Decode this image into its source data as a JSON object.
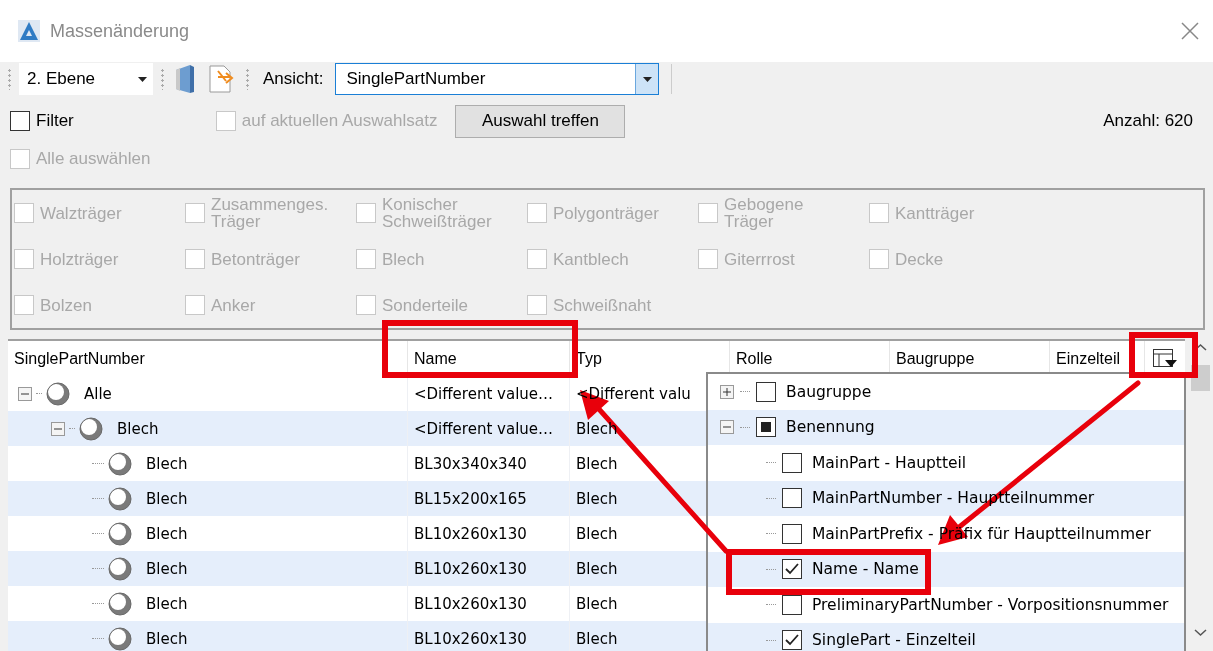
{
  "window": {
    "title": "Massenänderung"
  },
  "toolbar": {
    "level_combo": {
      "value": "2. Ebene"
    },
    "view_label": "Ansicht:",
    "view_combo": {
      "value": "SinglePartNumber"
    }
  },
  "filter": {
    "filter_checkbox": {
      "label": "Filter",
      "checked": false,
      "disabled": false
    },
    "selection_set_checkbox": {
      "label": "auf aktuellen Auswahlsatz",
      "checked": false,
      "disabled": true
    },
    "select_button": "Auswahl treffen",
    "count": "Anzahl: 620",
    "select_all": {
      "label": "Alle auswählen",
      "checked": false,
      "disabled": true
    }
  },
  "categories": [
    {
      "label": "Walzträger",
      "checked": false,
      "disabled": true
    },
    {
      "label": "Zusammenges.\nTräger",
      "checked": false,
      "disabled": true
    },
    {
      "label": "Konischer\nSchweißträger",
      "checked": false,
      "disabled": true
    },
    {
      "label": "Polygonträger",
      "checked": false,
      "disabled": true
    },
    {
      "label": "Gebogene\nTräger",
      "checked": false,
      "disabled": true
    },
    {
      "label": "Kantträger",
      "checked": false,
      "disabled": true
    },
    {
      "label": "Holzträger",
      "checked": false,
      "disabled": true
    },
    {
      "label": "Betonträger",
      "checked": false,
      "disabled": true
    },
    {
      "label": "Blech",
      "checked": false,
      "disabled": true
    },
    {
      "label": "Kantblech",
      "checked": false,
      "disabled": true
    },
    {
      "label": "Giterrrost",
      "checked": false,
      "disabled": true
    },
    {
      "label": "Decke",
      "checked": false,
      "disabled": true
    },
    {
      "label": "Bolzen",
      "checked": false,
      "disabled": true
    },
    {
      "label": "Anker",
      "checked": false,
      "disabled": true
    },
    {
      "label": "Sonderteile",
      "checked": false,
      "disabled": true
    },
    {
      "label": "Schweißnaht",
      "checked": false,
      "disabled": true
    }
  ],
  "table": {
    "columns": [
      "SinglePartNumber",
      "Name",
      "Typ",
      "Rolle",
      "Baugruppe",
      "Einzelteil"
    ],
    "rows": [
      {
        "label": "Alle",
        "name": "<Different value…",
        "type": "<Different valu",
        "expanded": true,
        "children": [
          {
            "label": "Blech",
            "name": "<Different value…",
            "type": "Blech",
            "expanded": true,
            "children": [
              {
                "label": "Blech",
                "name": "BL30x340x340",
                "type": "Blech"
              },
              {
                "label": "Blech",
                "name": "BL15x200x165",
                "type": "Blech"
              },
              {
                "label": "Blech",
                "name": "BL10x260x130",
                "type": "Blech"
              },
              {
                "label": "Blech",
                "name": "BL10x260x130",
                "type": "Blech"
              },
              {
                "label": "Blech",
                "name": "BL10x260x130",
                "type": "Blech"
              },
              {
                "label": "Blech",
                "name": "BL10x260x130",
                "type": "Blech"
              }
            ]
          }
        ]
      }
    ]
  },
  "column_chooser": {
    "items": [
      {
        "label": "Baugruppe",
        "checked": false,
        "partial": false,
        "expanded": false
      },
      {
        "label": "Benennung",
        "checked": false,
        "partial": true,
        "expanded": true,
        "children": [
          {
            "label": "MainPart - Hauptteil",
            "checked": false,
            "partial": false
          },
          {
            "label": "MainPartNumber - Hauptteilnummer",
            "checked": false,
            "partial": false
          },
          {
            "label": "MainPartPrefix - Präfix für Hauptteilnummer",
            "checked": false,
            "partial": false
          },
          {
            "label": "Name - Name",
            "checked": true,
            "partial": false
          },
          {
            "label": "PreliminaryPartNumber - Vorpositionsnummer",
            "checked": false,
            "partial": false
          },
          {
            "label": "SinglePart - Einzelteil",
            "checked": true,
            "partial": false
          }
        ]
      }
    ]
  }
}
